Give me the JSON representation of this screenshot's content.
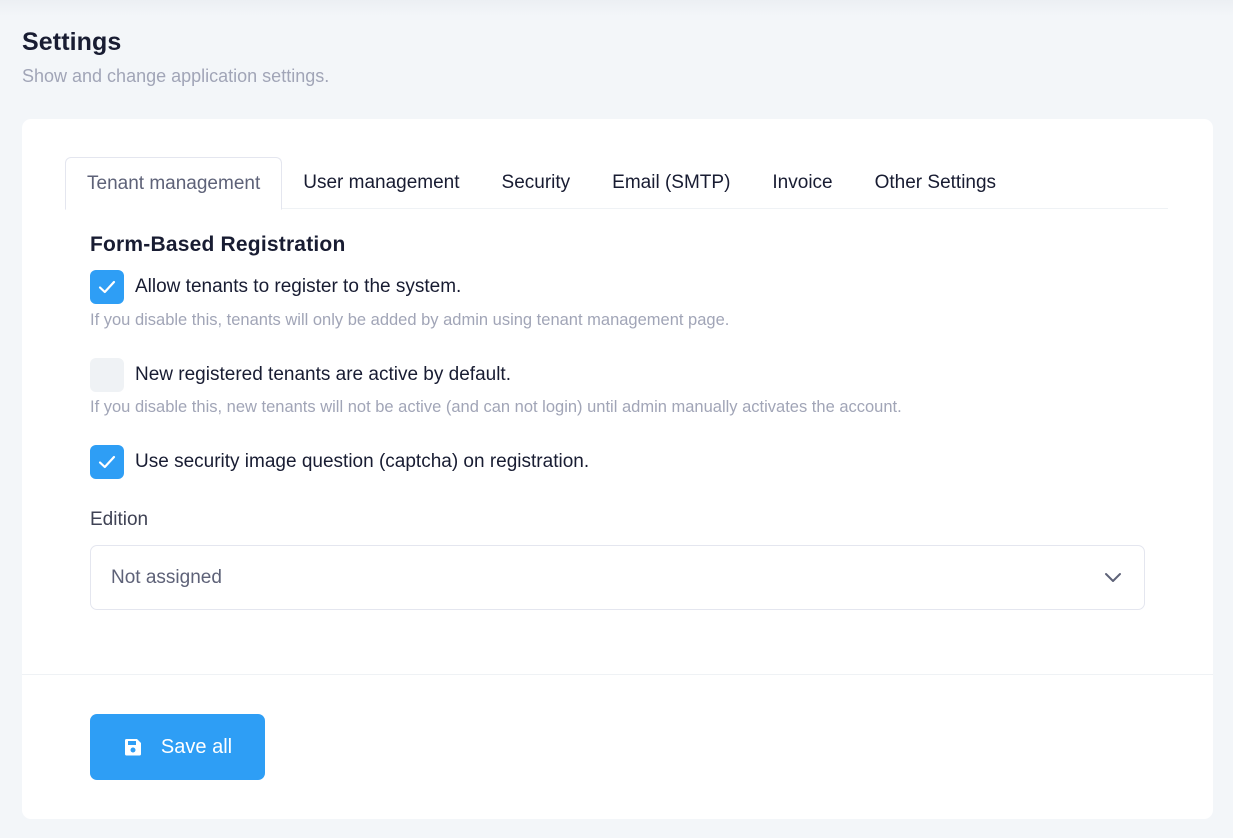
{
  "header": {
    "title": "Settings",
    "subtitle": "Show and change application settings."
  },
  "tabs": [
    {
      "label": "Tenant management",
      "active": true
    },
    {
      "label": "User management",
      "active": false
    },
    {
      "label": "Security",
      "active": false
    },
    {
      "label": "Email (SMTP)",
      "active": false
    },
    {
      "label": "Invoice",
      "active": false
    },
    {
      "label": "Other Settings",
      "active": false
    }
  ],
  "form": {
    "section_title": "Form-Based Registration",
    "options": [
      {
        "label": "Allow tenants to register to the system.",
        "checked": true,
        "hint": "If you disable this, tenants will only be added by admin using tenant management page."
      },
      {
        "label": "New registered tenants are active by default.",
        "checked": false,
        "hint": "If you disable this, new tenants will not be active (and can not login) until admin manually activates the account."
      },
      {
        "label": "Use security image question (captcha) on registration.",
        "checked": true,
        "hint": ""
      }
    ],
    "edition": {
      "label": "Edition",
      "value": "Not assigned"
    }
  },
  "footer": {
    "save_label": "Save all",
    "save_icon": "floppy-disk-icon"
  },
  "colors": {
    "primary": "#2e9ef5",
    "text": "#181c32",
    "muted": "#a1a5b7"
  }
}
